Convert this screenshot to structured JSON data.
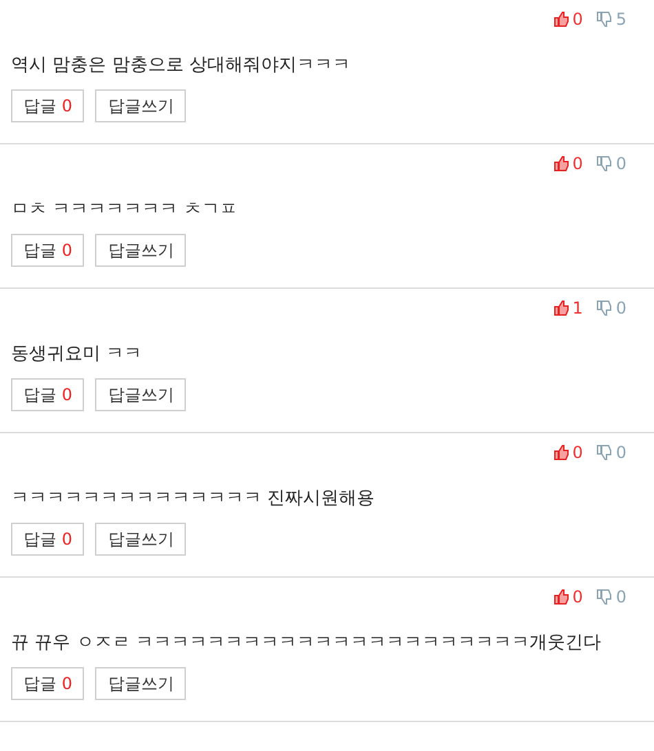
{
  "comments": [
    {
      "likes": "0",
      "dislikes": "5",
      "text": "역시 맘충은 맘충으로 상대해줘야지ㅋㅋㅋ",
      "reply_label": "답글",
      "reply_count": "0",
      "write_label": "답글쓰기"
    },
    {
      "likes": "0",
      "dislikes": "0",
      "text": "ㅁㅊ ㅋㅋㅋㅋㅋㅋㅋ ㅊㄱㅍ",
      "reply_label": "답글",
      "reply_count": "0",
      "write_label": "답글쓰기"
    },
    {
      "likes": "1",
      "dislikes": "0",
      "text": "동생귀요미 ㅋㅋ",
      "reply_label": "답글",
      "reply_count": "0",
      "write_label": "답글쓰기"
    },
    {
      "likes": "0",
      "dislikes": "0",
      "text": "ㅋㅋㅋㅋㅋㅋㅋㅋㅋㅋㅋㅋㅋㅋ 진짜시원해용",
      "reply_label": "답글",
      "reply_count": "0",
      "write_label": "답글쓰기"
    },
    {
      "likes": "0",
      "dislikes": "0",
      "text": "뀨 뀨우 ㅇㅈㄹ ㅋㅋㅋㅋㅋㅋㅋㅋㅋㅋㅋㅋㅋㅋㅋㅋㅋㅋㅋㅋㅋㅋ개웃긴다",
      "reply_label": "답글",
      "reply_count": "0",
      "write_label": "답글쓰기"
    }
  ]
}
